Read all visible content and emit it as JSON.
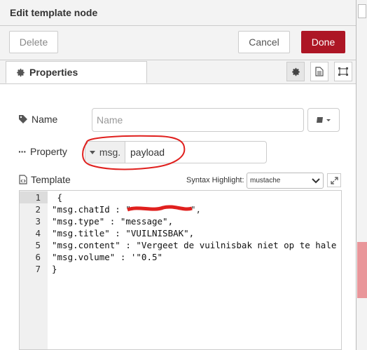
{
  "title": "Edit template node",
  "toolbar": {
    "delete_label": "Delete",
    "cancel_label": "Cancel",
    "done_label": "Done"
  },
  "colors": {
    "done_bg": "#ad1625",
    "highlight_scribble": "#e0201e"
  },
  "tabs": {
    "properties_label": "Properties",
    "icons": [
      "gear-icon",
      "description-icon",
      "appearance-icon"
    ]
  },
  "form": {
    "name_label": "Name",
    "name_placeholder": "Name",
    "property_label": "Property",
    "property_prefix": "msg.",
    "property_value": "payload",
    "template_label": "Template",
    "syntax_label": "Syntax Highlight:",
    "syntax_value": "mustache"
  },
  "editor": {
    "lines": [
      {
        "num": "1",
        "code": " {"
      },
      {
        "num": "2",
        "code": "\"msg.chatId : \""
      },
      {
        "num": "3",
        "code": "\"msg.type\" : \"message\","
      },
      {
        "num": "4",
        "code": "\"msg.title\" : \"VUILNISBAK\","
      },
      {
        "num": "5",
        "code": "\"msg.content\" : \"Vergeet de vuilnisbak niet op te hale"
      },
      {
        "num": "6",
        "code": "\"msg.volume\" : '\"0.5\""
      },
      {
        "num": "7",
        "code": "}"
      }
    ]
  }
}
